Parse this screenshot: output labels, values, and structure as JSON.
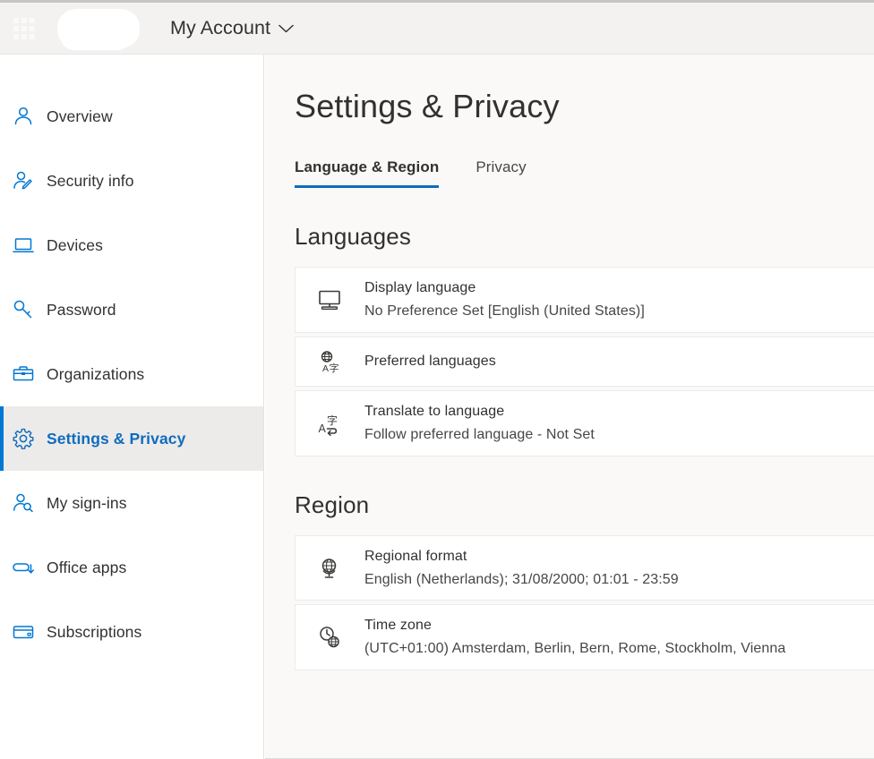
{
  "topbar": {
    "waffle_icon": "app-launcher-grid-icon",
    "logo": "redacted-logo-blob",
    "account_label": "My Account",
    "chevron_icon": "chevron-down-icon"
  },
  "sidebar": {
    "items": [
      {
        "label": "Overview",
        "icon": "person-icon",
        "selected": false
      },
      {
        "label": "Security info",
        "icon": "person-edit-icon",
        "selected": false
      },
      {
        "label": "Devices",
        "icon": "laptop-icon",
        "selected": false
      },
      {
        "label": "Password",
        "icon": "key-icon",
        "selected": false
      },
      {
        "label": "Organizations",
        "icon": "briefcase-icon",
        "selected": false
      },
      {
        "label": "Settings & Privacy",
        "icon": "gear-icon",
        "selected": true
      },
      {
        "label": "My sign-ins",
        "icon": "person-search-icon",
        "selected": false
      },
      {
        "label": "Office apps",
        "icon": "app-download-icon",
        "selected": false
      },
      {
        "label": "Subscriptions",
        "icon": "credit-card-icon",
        "selected": false
      }
    ]
  },
  "main": {
    "page_title": "Settings & Privacy",
    "tabs": [
      {
        "label": "Language & Region",
        "active": true
      },
      {
        "label": "Privacy",
        "active": false
      }
    ],
    "sections": [
      {
        "title": "Languages",
        "cards": [
          {
            "icon": "monitor-icon",
            "title": "Display language",
            "subtitle": "No Preference Set [English (United States)]"
          },
          {
            "icon": "globe-translate-icon",
            "title": "Preferred languages",
            "subtitle": ""
          },
          {
            "icon": "translate-icon",
            "title": "Translate to language",
            "subtitle": "Follow preferred language - Not Set"
          }
        ]
      },
      {
        "title": "Region",
        "cards": [
          {
            "icon": "desk-globe-icon",
            "title": "Regional format",
            "subtitle": "English (Netherlands); 31/08/2000; 01:01 - 23:59"
          },
          {
            "icon": "clock-globe-icon",
            "title": "Time zone",
            "subtitle": "(UTC+01:00) Amsterdam, Berlin, Bern, Rome, Stockholm, Vienna"
          }
        ]
      }
    ]
  },
  "colors": {
    "accent": "#0f6cbd",
    "icon_blue": "#0078d4",
    "header_bg": "#f3f2f1",
    "content_bg": "#faf9f8",
    "selected_bg": "#edebe9",
    "text": "#323130"
  }
}
